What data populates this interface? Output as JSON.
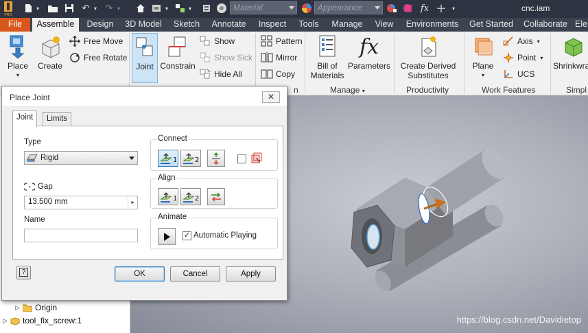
{
  "app": {
    "title": "cnc.iam",
    "logo_text": "PRO"
  },
  "quick_access": {
    "material_placeholder": "Material",
    "appearance_placeholder": "Appearance",
    "fx_label": "fx"
  },
  "tabs": [
    {
      "label": "File"
    },
    {
      "label": "Assemble"
    },
    {
      "label": "Design"
    },
    {
      "label": "3D Model"
    },
    {
      "label": "Sketch"
    },
    {
      "label": "Annotate"
    },
    {
      "label": "Inspect"
    },
    {
      "label": "Tools"
    },
    {
      "label": "Manage"
    },
    {
      "label": "View"
    },
    {
      "label": "Environments"
    },
    {
      "label": "Get Started"
    },
    {
      "label": "Collaborate"
    },
    {
      "label": "Ele"
    }
  ],
  "ribbon": {
    "place": "Place",
    "create": "Create",
    "free_move": "Free Move",
    "free_rotate": "Free Rotate",
    "joint": "Joint",
    "constrain": "Constrain",
    "show": "Show",
    "show_sick": "Show Sick",
    "hide_all": "Hide All",
    "pattern": "Pattern",
    "mirror": "Mirror",
    "copy": "Copy",
    "bill_of_materials_1": "Bill of",
    "bill_of_materials_2": "Materials",
    "parameters": "Parameters",
    "create_derived_1": "Create Derived",
    "create_derived_2": "Substitutes",
    "plane": "Plane",
    "axis": "Axis",
    "point": "Point",
    "ucs": "UCS",
    "shrinkwrap": "Shrinkwra",
    "panels": {
      "pattern_panel": "n",
      "manage": "Manage",
      "productivity": "Productivity",
      "work_features": "Work Features",
      "simplify": "Simpl"
    }
  },
  "dialog": {
    "title": "Place Joint",
    "close": "✕",
    "tabs": {
      "joint": "Joint",
      "limits": "Limits"
    },
    "type_label": "Type",
    "type_value": "Rigid",
    "gap_label": "Gap",
    "gap_value": "13.500 mm",
    "name_label": "Name",
    "name_value": "",
    "connect_label": "Connect",
    "align_label": "Align",
    "animate_label": "Animate",
    "btn_1": "1",
    "btn_2": "2",
    "automatic_playing": "Automatic Playing",
    "automatic_playing_checked": true,
    "help": "?",
    "ok": "OK",
    "cancel": "Cancel",
    "apply": "Apply"
  },
  "browser": {
    "items": [
      {
        "label": "Origin"
      },
      {
        "label": "tool_fix_screw:1"
      }
    ]
  },
  "viewport": {
    "watermark": "https://blog.csdn.net/Davidietop"
  }
}
